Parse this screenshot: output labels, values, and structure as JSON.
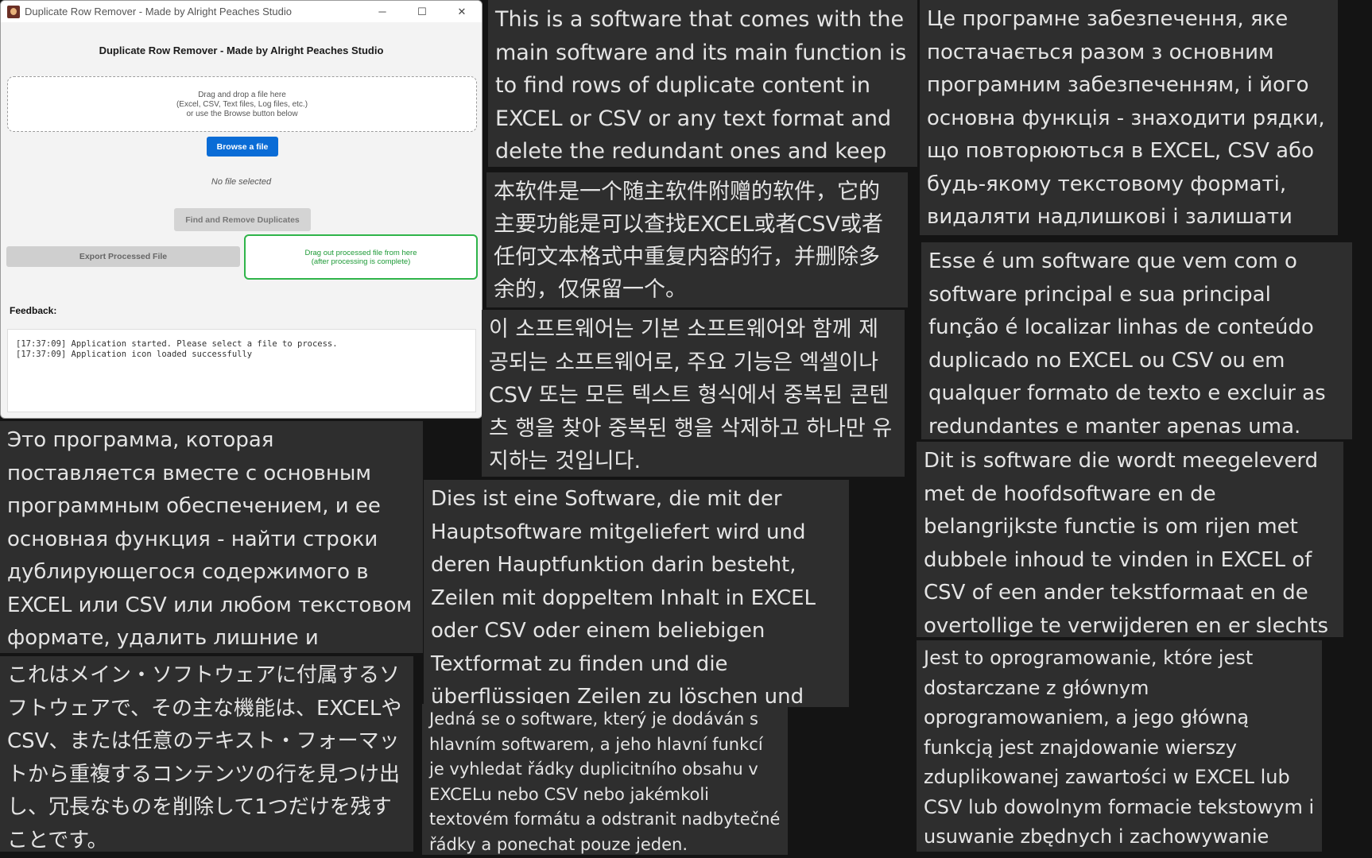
{
  "window": {
    "title": "Duplicate Row Remover - Made by Alright Peaches Studio",
    "controls": {
      "minimize": "─",
      "maximize": "☐",
      "close": "✕"
    },
    "heading": "Duplicate Row Remover - Made by Alright Peaches Studio",
    "dropzone": {
      "line1": "Drag and drop a file here",
      "line2": "(Excel, CSV, Text files, Log files, etc.)",
      "line3": "or use the Browse button below"
    },
    "browse_label": "Browse a file",
    "status_text": "No file selected",
    "find_label": "Find and Remove Duplicates",
    "export_label": "Export Processed File",
    "dragout": {
      "line1": "Drag out processed file from here",
      "line2": "(after processing is complete)"
    },
    "feedback_label": "Feedback:",
    "log": [
      "[17:37:09] Application started. Please select a file to process.",
      "[17:37:09] Application icon loaded successfully"
    ]
  },
  "descriptions": {
    "en": "This is a software that comes with the main software and its main function is to find rows of duplicate content in EXCEL or CSV or any text format and delete the redundant ones and keep only one.",
    "uk": "Це програмне забезпечення, яке постачається разом з основним програмним забезпеченням, і його основна функція - знаходити рядки, що повторюються в EXCEL, CSV або будь-якому текстовому форматі, видаляти надлишкові і залишати тільки один.",
    "zh": "本软件是一个随主软件附赠的软件，它的主要功能是可以查找EXCEL或者CSV或者任何文本格式中重复内容的行，并删除多余的，仅保留一个。",
    "pt": "Esse é um software que vem com o software principal e sua principal função é localizar linhas de conteúdo duplicado no EXCEL ou CSV ou em qualquer formato de texto e excluir as redundantes e manter apenas uma.",
    "ko": "이 소프트웨어는 기본 소프트웨어와 함께 제공되는 소프트웨어로, 주요 기능은 엑셀이나 CSV 또는 모든 텍스트 형식에서 중복된 콘텐츠 행을 찾아 중복된 행을 삭제하고 하나만 유지하는 것입니다.",
    "ru": "Это программа, которая поставляется вместе с основным программным обеспечением, и ее основная функция - найти строки дублирующегося содержимого в EXCEL или CSV или любом текстовом формате, удалить лишние и оставить только одну.",
    "nl": "Dit is software die wordt meegeleverd met de hoofdsoftware en de belangrijkste functie is om rijen met dubbele inhoud te vinden in EXCEL of CSV of een ander tekstformaat en de overtollige te verwijderen en er slechts één te behouden.",
    "de": "Dies ist eine Software, die mit der Hauptsoftware mitgeliefert wird und deren Hauptfunktion darin besteht, Zeilen mit doppeltem Inhalt in EXCEL oder CSV oder einem beliebigen Textformat zu finden und die überflüssigen Zeilen zu löschen und nur eine zu behalten.",
    "ja": "これはメイン・ソフトウェアに付属するソフトウェアで、その主な機能は、EXCELやCSV、または任意のテキスト・フォーマットから重複するコンテンツの行を見つけ出し、冗長なものを削除して1つだけを残すことです。",
    "pl": "Jest to oprogramowanie, które jest dostarczane z głównym oprogramowaniem, a jego główną funkcją jest znajdowanie wierszy zduplikowanej zawartości w EXCEL lub CSV lub dowolnym formacie tekstowym i usuwanie zbędnych i zachowywanie tylko jednego.",
    "cs": "Jedná se o software, který je dodáván s hlavním softwarem, a jeho hlavní funkcí je vyhledat řádky duplicitního obsahu v EXCELu nebo CSV nebo jakémkoli textovém formátu a odstranit nadbytečné řádky a ponechat pouze jeden."
  }
}
